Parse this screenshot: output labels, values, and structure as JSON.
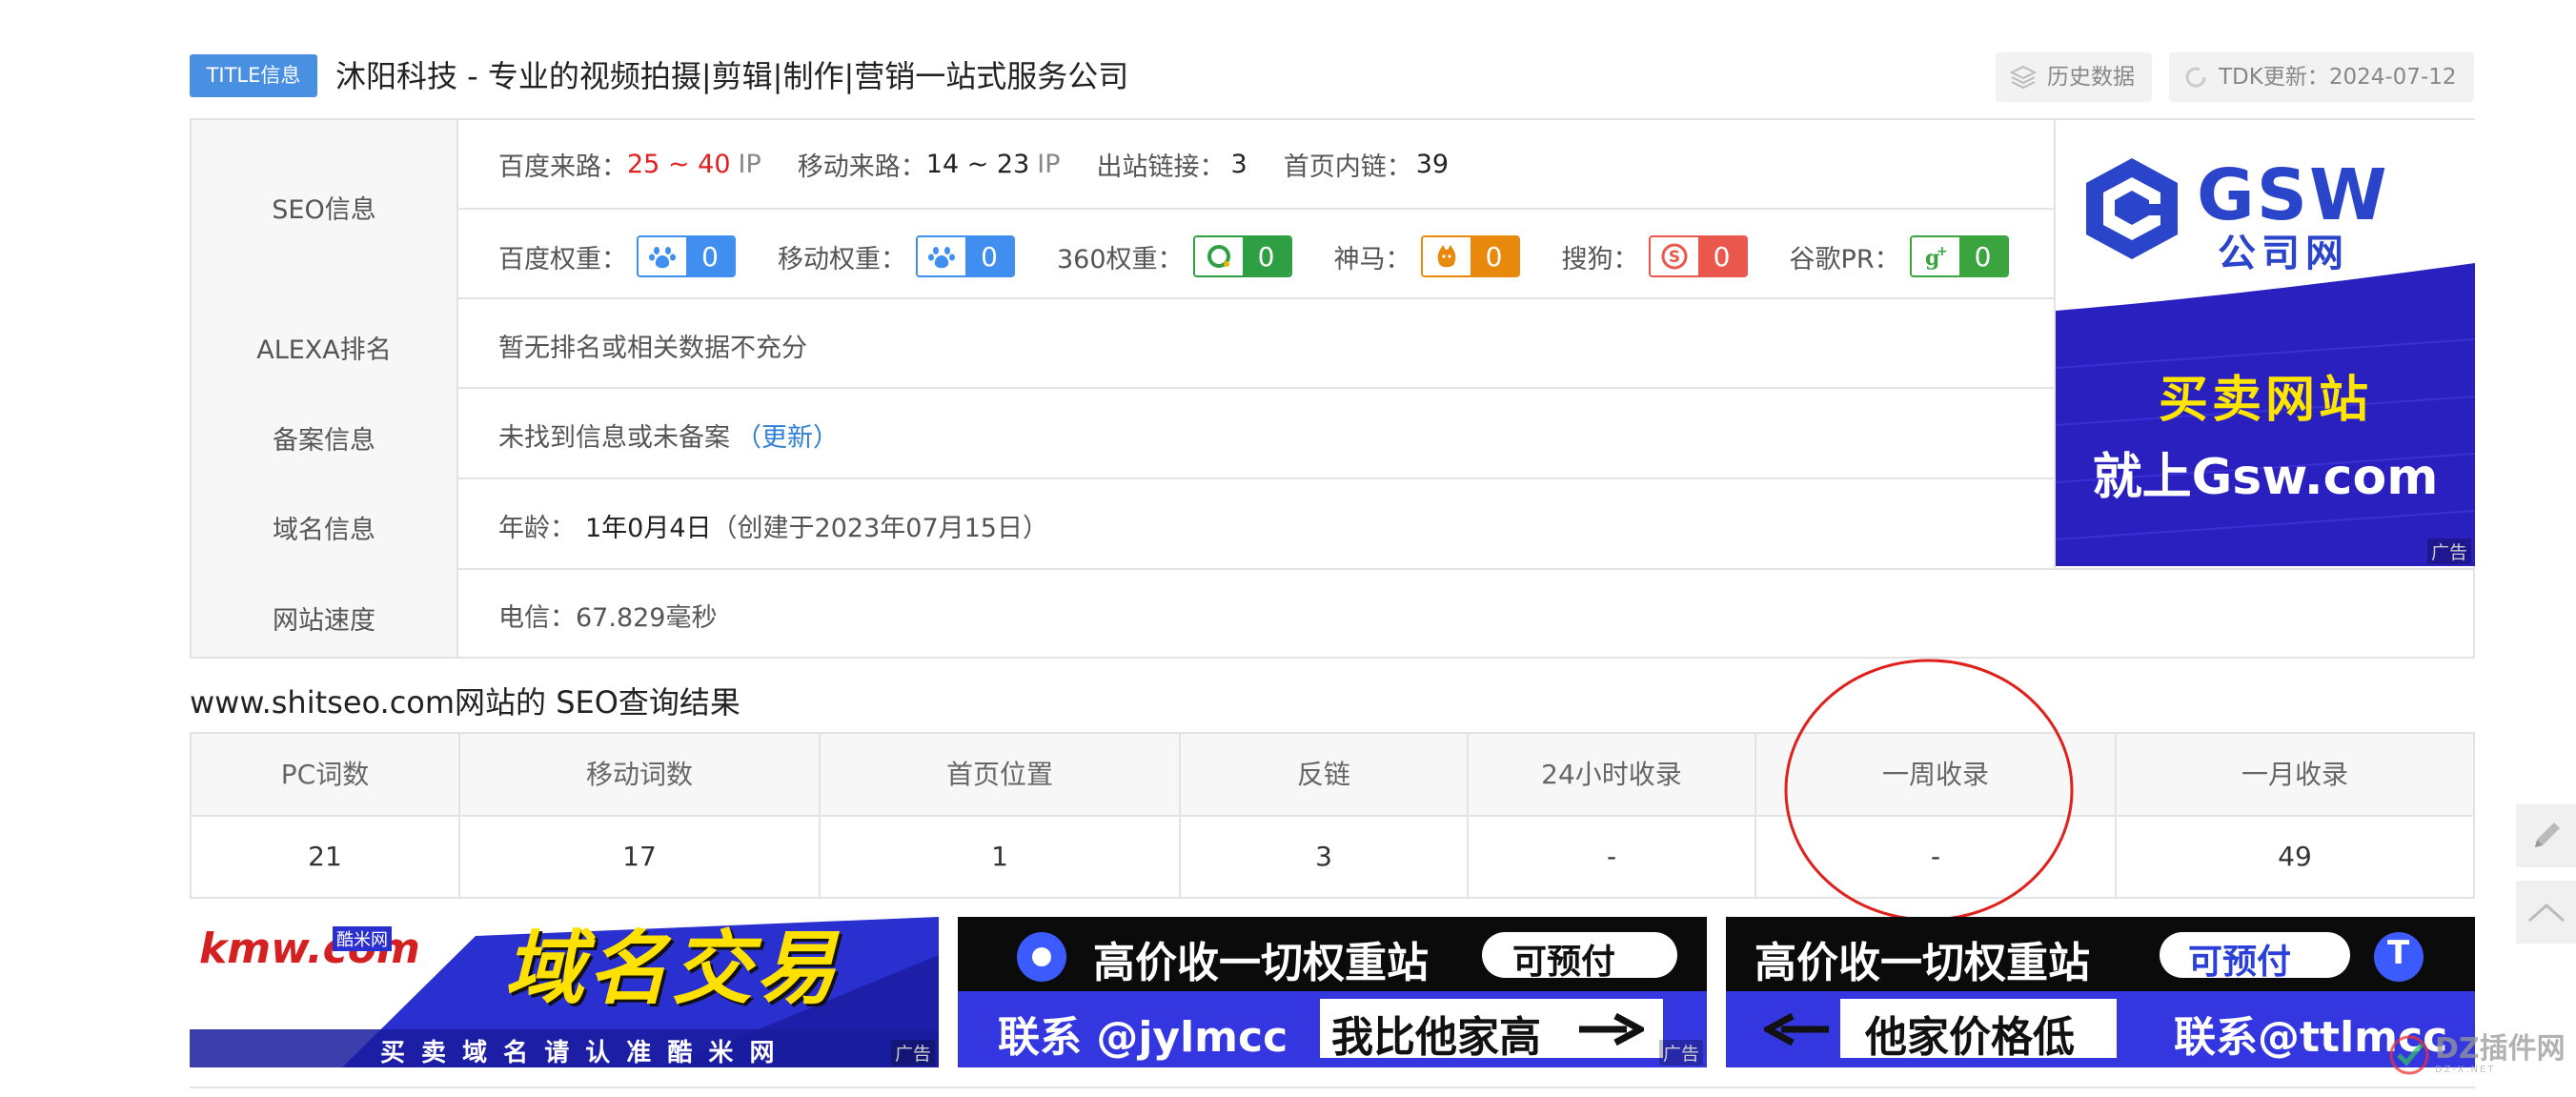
{
  "header": {
    "badge": "TITLE信息",
    "site_title": "沐阳科技 - 专业的视频拍摄|剪辑|制作|营销一站式服务公司",
    "history_button": "历史数据",
    "tdk_update": "TDK更新：2024-07-12"
  },
  "seo_info": {
    "label": "SEO信息",
    "traffic": [
      {
        "label": "百度来路：",
        "value": "25 ~ 40",
        "unit": "IP"
      },
      {
        "label": "移动来路：",
        "value": "14 ~ 23",
        "unit": "IP"
      },
      {
        "label": "出站链接：",
        "value": "3"
      },
      {
        "label": "首页内链：",
        "value": "39"
      }
    ],
    "weights": [
      {
        "label": "百度权重：",
        "value": "0",
        "icon": "baidu-paw-icon",
        "color": "#3f8ef0"
      },
      {
        "label": "移动权重：",
        "value": "0",
        "icon": "mobile-paw-icon",
        "color": "#3f8ef0"
      },
      {
        "label": "360权重：",
        "value": "0",
        "icon": "so360-icon",
        "color": "#2ea043"
      },
      {
        "label": "神马：",
        "value": "0",
        "icon": "shenma-horse-icon",
        "color": "#e8890c"
      },
      {
        "label": "搜狗：",
        "value": "0",
        "icon": "sogou-icon",
        "color": "#e9574d"
      },
      {
        "label": "谷歌PR：",
        "value": "0",
        "icon": "google-plus-icon",
        "color": "#3aa53f"
      }
    ]
  },
  "alexa": {
    "label": "ALEXA排名",
    "value": "暂无排名或相关数据不充分"
  },
  "beian": {
    "label": "备案信息",
    "value": "未找到信息或未备案",
    "update_link": "（更新）"
  },
  "domain": {
    "label": "域名信息",
    "age_label": "年龄：",
    "age": "1年0月4日",
    "created": "（创建于2023年07月15日）"
  },
  "speed": {
    "label": "网站速度",
    "value": "电信：67.829毫秒"
  },
  "gsw_ad": {
    "brand": "GSW",
    "brand_sub": "公司网",
    "line1": "买卖网站",
    "line2": "就上Gsw.com",
    "ad_tag": "广告"
  },
  "results": {
    "title": "www.shitseo.com网站的 SEO查询结果",
    "headers": [
      "PC词数",
      "移动词数",
      "首页位置",
      "反链",
      "24小时收录",
      "一周收录",
      "一月收录"
    ],
    "values": [
      "21",
      "17",
      "1",
      "3",
      "-",
      "-",
      "49"
    ]
  },
  "banners": [
    {
      "brand": "kmw.com",
      "brand_tag": "酷米网",
      "headline": "域名交易",
      "footer": "买 卖 域 名 请 认 准 酷 米 网",
      "ad_tag": "广告"
    },
    {
      "line1": "高价收一切权重站",
      "tag": "可预付",
      "line2_left": "联系 @jylmcc",
      "line2_right": "我比他家高",
      "ad_tag": "广告"
    },
    {
      "line1": "高价收一切权重站",
      "tag": "可预付",
      "line2_left": "他家价格低",
      "line2_right": "联系@ttlmcc"
    }
  ],
  "watermark": {
    "text": "DZ插件网",
    "sub": "DZ-X.NET"
  }
}
